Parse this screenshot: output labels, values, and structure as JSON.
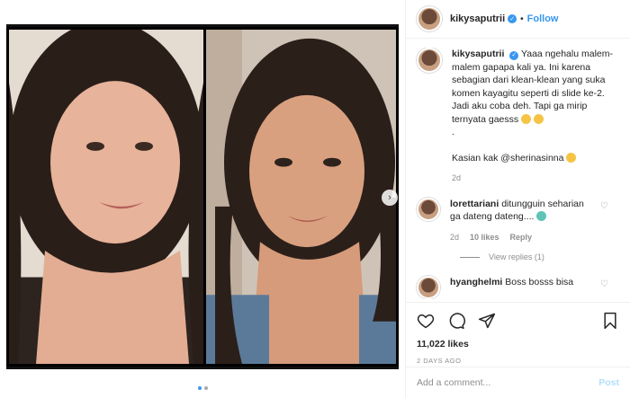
{
  "post": {
    "username": "kikysaputrii",
    "separator": "•",
    "follow_label": "Follow",
    "caption_lines": [
      "Yaaa ngehalu malem-",
      "malem gapapa kali ya. Ini karena",
      "sebagian dari klean-klean yang suka",
      "komen kayagitu seperti di slide ke-2.",
      "Jadi aku coba deh. Tapi ga mirip",
      "ternyata gaesss",
      ".",
      "",
      "Kasian kak @sherinasinna"
    ],
    "caption_age": "2d"
  },
  "comments": [
    {
      "username": "lorettariani",
      "text_line1": "ditungguin seharian",
      "text_line2": "ga dateng dateng....",
      "age": "2d",
      "likes": "10 likes",
      "reply_label": "Reply",
      "view_replies": "View replies (1)"
    },
    {
      "username": "hyanghelmi",
      "text": "Boss bosss bisa"
    }
  ],
  "actions": {
    "likes": "11,022 likes",
    "time_ago": "2 DAYS AGO"
  },
  "add_comment": {
    "placeholder": "Add a comment...",
    "post_label": "Post"
  },
  "icons": {
    "verified": "verified-badge-icon",
    "like": "heart-icon",
    "comment": "comment-bubble-icon",
    "share": "paper-plane-icon",
    "save": "bookmark-icon",
    "next": "chevron-right-icon"
  },
  "colors": {
    "accent": "#3897f0",
    "muted": "#8e8e8e",
    "text": "#262626"
  },
  "carousel": {
    "slide_count": 2,
    "active_slide": 1
  }
}
